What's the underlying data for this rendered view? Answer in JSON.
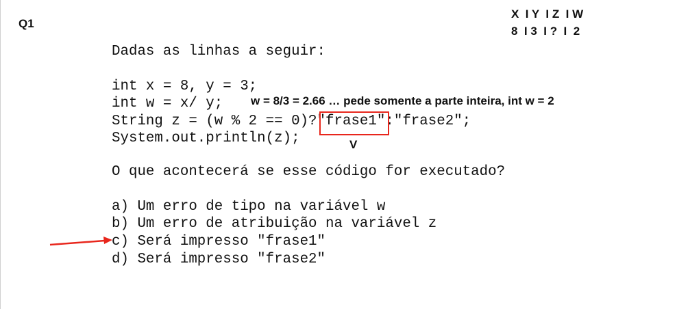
{
  "question_label": "Q1",
  "trace_table": {
    "header": "X  I Y  I Z  I W",
    "values": "8  I 3  I ?  I  2"
  },
  "question": {
    "intro": "Dadas as linhas a seguir:",
    "code": [
      "int x = 8, y = 3;",
      "int w = x/ y;",
      "String z = (w % 2 == 0)?\"frase1\":\"frase2\";",
      "System.out.println(z);"
    ],
    "prompt": "O que acontecerá se esse código for executado?",
    "options": [
      "a) Um erro de tipo na variável w",
      "b) Um erro de atribuição na variável z",
      "c) Será impresso \"frase1\"",
      "d) Será impresso \"frase2\""
    ]
  },
  "annotations": {
    "w_note": "w = 8/3 = 2.66 … pede somente a parte inteira, int w = 2",
    "true_mark": "V",
    "highlight_color": "#e8261c",
    "selected_option": "c"
  }
}
